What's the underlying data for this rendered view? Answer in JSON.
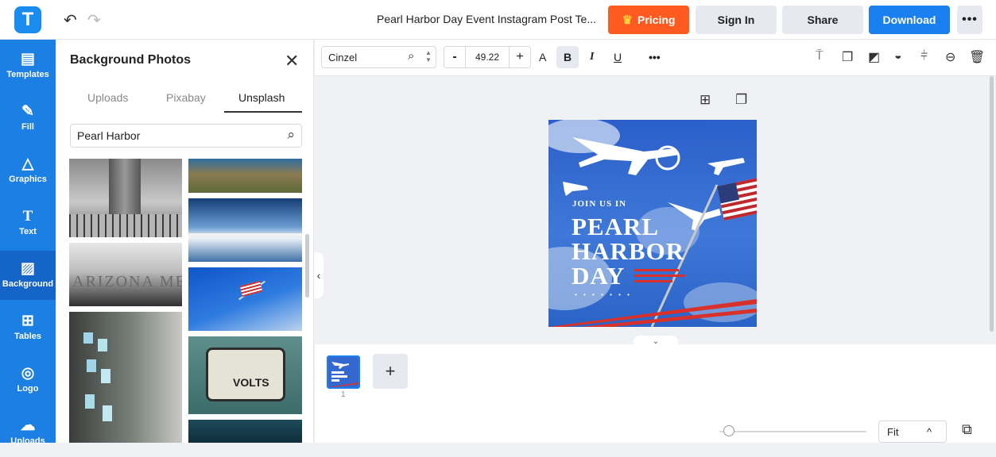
{
  "header": {
    "logo_letter": "T",
    "undo_icon": "↶",
    "redo_icon": "↷",
    "title": "Pearl Harbor Day Event Instagram Post Te...",
    "pricing_label": "Pricing",
    "signin_label": "Sign In",
    "share_label": "Share",
    "download_label": "Download",
    "more_label": "•••",
    "accent_orange": "#ff5a1f",
    "accent_blue": "#1a7fef"
  },
  "sidebar": {
    "items": [
      {
        "label": "Templates",
        "icon": "templates-icon"
      },
      {
        "label": "Fill",
        "icon": "pencil-icon"
      },
      {
        "label": "Graphics",
        "icon": "shapes-icon"
      },
      {
        "label": "Text",
        "icon": "text-icon"
      },
      {
        "label": "Background",
        "icon": "background-icon"
      },
      {
        "label": "Tables",
        "icon": "table-icon"
      },
      {
        "label": "Logo",
        "icon": "logo-icon"
      },
      {
        "label": "Uploads",
        "icon": "cloud-upload-icon"
      }
    ],
    "active": "Background"
  },
  "panel": {
    "title": "Background Photos",
    "tabs": [
      "Uploads",
      "Pixabay",
      "Unsplash"
    ],
    "active_tab": "Unsplash",
    "search_value": "Pearl Harbor"
  },
  "format_bar": {
    "font_name": "Cinzel",
    "font_size": "49.22",
    "minus": "-",
    "plus": "+",
    "text_a": "A",
    "bold": "B",
    "italic": "I",
    "underline": "U",
    "more": "•••"
  },
  "design": {
    "join": "JOIN US IN",
    "line1": "PEARL",
    "line2": "HARBOR",
    "line3": "DAY",
    "dots": "• • • • • • •"
  },
  "pages": {
    "current_number": "1",
    "add_label": "+"
  },
  "zoom": {
    "value": "Fit",
    "chevron": "^"
  }
}
